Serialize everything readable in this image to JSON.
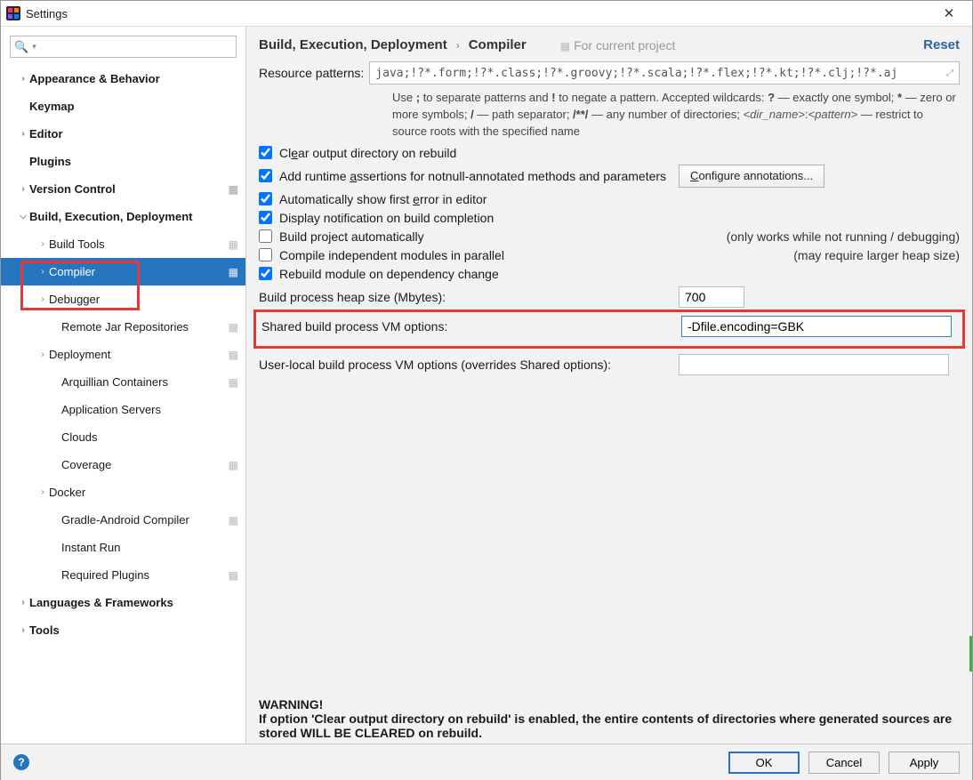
{
  "window": {
    "title": "Settings"
  },
  "sidebar": {
    "search_placeholder": "",
    "items": [
      {
        "label": "Appearance & Behavior",
        "level": 0,
        "arrow": ">",
        "proj": false
      },
      {
        "label": "Keymap",
        "level": 0,
        "arrow": "",
        "proj": false
      },
      {
        "label": "Editor",
        "level": 0,
        "arrow": ">",
        "proj": false
      },
      {
        "label": "Plugins",
        "level": 0,
        "arrow": "",
        "proj": false
      },
      {
        "label": "Version Control",
        "level": 0,
        "arrow": ">",
        "proj": true
      },
      {
        "label": "Build, Execution, Deployment",
        "level": 0,
        "arrow": "v",
        "proj": false
      },
      {
        "label": "Build Tools",
        "level": 1,
        "arrow": ">",
        "proj": true
      },
      {
        "label": "Compiler",
        "level": 1,
        "arrow": ">",
        "proj": true,
        "selected": true
      },
      {
        "label": "Debugger",
        "level": 1,
        "arrow": ">",
        "proj": false
      },
      {
        "label": "Remote Jar Repositories",
        "level": 2,
        "arrow": "",
        "proj": true
      },
      {
        "label": "Deployment",
        "level": 1,
        "arrow": ">",
        "proj": true
      },
      {
        "label": "Arquillian Containers",
        "level": 2,
        "arrow": "",
        "proj": true
      },
      {
        "label": "Application Servers",
        "level": 2,
        "arrow": "",
        "proj": false
      },
      {
        "label": "Clouds",
        "level": 2,
        "arrow": "",
        "proj": false
      },
      {
        "label": "Coverage",
        "level": 2,
        "arrow": "",
        "proj": true
      },
      {
        "label": "Docker",
        "level": 1,
        "arrow": ">",
        "proj": false
      },
      {
        "label": "Gradle-Android Compiler",
        "level": 2,
        "arrow": "",
        "proj": true
      },
      {
        "label": "Instant Run",
        "level": 2,
        "arrow": "",
        "proj": false
      },
      {
        "label": "Required Plugins",
        "level": 2,
        "arrow": "",
        "proj": true
      },
      {
        "label": "Languages & Frameworks",
        "level": 0,
        "arrow": ">",
        "proj": false
      },
      {
        "label": "Tools",
        "level": 0,
        "arrow": ">",
        "proj": false
      }
    ]
  },
  "header": {
    "crumb1": "Build, Execution, Deployment",
    "crumb2": "Compiler",
    "for_project": "For current project",
    "reset": "Reset"
  },
  "resource": {
    "label": "Resource patterns:",
    "value": "java;!?*.form;!?*.class;!?*.groovy;!?*.scala;!?*.flex;!?*.kt;!?*.clj;!?*.aj",
    "help": "Use ; to separate patterns and ! to negate a pattern. Accepted wildcards: ? — exactly one symbol; * — zero or more symbols; / — path separator; /**/ — any number of directories; <dir_name>:<pattern> — restrict to source roots with the specified name"
  },
  "checks": {
    "clear": "Clear output directory on rebuild",
    "assert": "Add runtime assertions for notnull-annotated methods and parameters",
    "assert_btn": "Configure annotations...",
    "autoerr": "Automatically show first error in editor",
    "notify": "Display notification on build completion",
    "autobuild": "Build project automatically",
    "autobuild_hint": "(only works while not running / debugging)",
    "parallel": "Compile independent modules in parallel",
    "parallel_hint": "(may require larger heap size)",
    "rebuild": "Rebuild module on dependency change"
  },
  "fields": {
    "heap_label": "Build process heap size (Mbytes):",
    "heap_value": "700",
    "shared_label": "Shared build process VM options:",
    "shared_value": "-Dfile.encoding=GBK",
    "local_label": "User-local build process VM options (overrides Shared options):",
    "local_value": ""
  },
  "warning": {
    "title": "WARNING!",
    "body": "If option 'Clear output directory on rebuild' is enabled, the entire contents of directories where generated sources are stored WILL BE CLEARED on rebuild."
  },
  "footer": {
    "ok": "OK",
    "cancel": "Cancel",
    "apply": "Apply"
  }
}
